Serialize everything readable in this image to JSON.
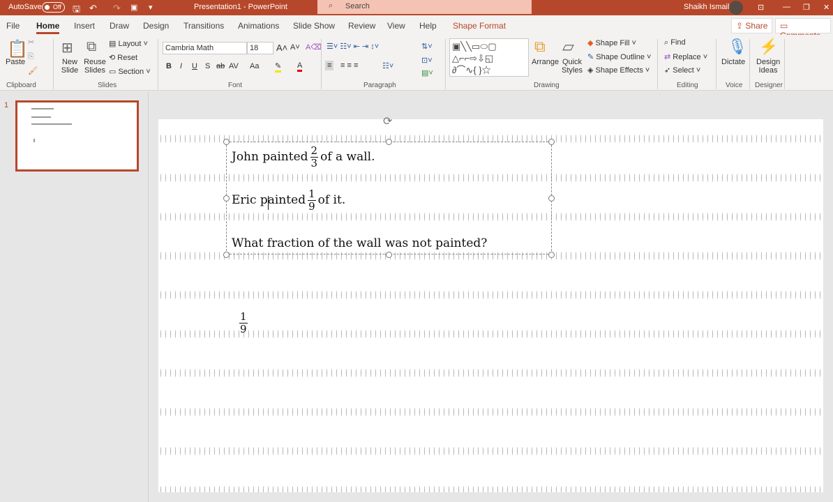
{
  "titlebar": {
    "autosave": "AutoSave",
    "autosave_state": "Off",
    "title": "Presentation1  -  PowerPoint",
    "search_placeholder": "Search",
    "user": "Shaikh Ismail"
  },
  "tabs": [
    "File",
    "Home",
    "Insert",
    "Draw",
    "Design",
    "Transitions",
    "Animations",
    "Slide Show",
    "Review",
    "View",
    "Help",
    "Shape Format"
  ],
  "active_tab": "Home",
  "share": "Share",
  "comments": "Comments",
  "ribbon": {
    "clipboard": {
      "paste": "Paste",
      "group": "Clipboard"
    },
    "slides": {
      "new_slide": "New Slide",
      "reuse_slides": "Reuse Slides",
      "layout": "Layout",
      "reset": "Reset",
      "section": "Section",
      "group": "Slides"
    },
    "font": {
      "font_name": "Cambria Math",
      "font_size": "18",
      "group": "Font",
      "bold": "B",
      "italic": "I",
      "underline": "U",
      "shadow": "S",
      "strike": "ab",
      "spacing": "AV",
      "case": "Aa"
    },
    "paragraph": {
      "group": "Paragraph"
    },
    "drawing": {
      "arrange": "Arrange",
      "quick_styles": "Quick Styles",
      "shape_fill": "Shape Fill",
      "shape_outline": "Shape Outline",
      "shape_effects": "Shape Effects",
      "group": "Drawing"
    },
    "editing": {
      "find": "Find",
      "replace": "Replace",
      "select": "Select",
      "group": "Editing"
    },
    "voice": {
      "dictate": "Dictate",
      "group": "Voice"
    },
    "designer": {
      "design_ideas": "Design Ideas",
      "group": "Designer"
    }
  },
  "thumbnail": {
    "number": "1"
  },
  "slide": {
    "line1": {
      "before": "John painted",
      "num": "2",
      "den": "3",
      "after": "of a wall."
    },
    "line2": {
      "before": "Eric painted",
      "num": "1",
      "den": "9",
      "after": "of it."
    },
    "line3": "What fraction of the wall was not painted?",
    "loose_fraction": {
      "num": "1",
      "den": "9"
    }
  }
}
